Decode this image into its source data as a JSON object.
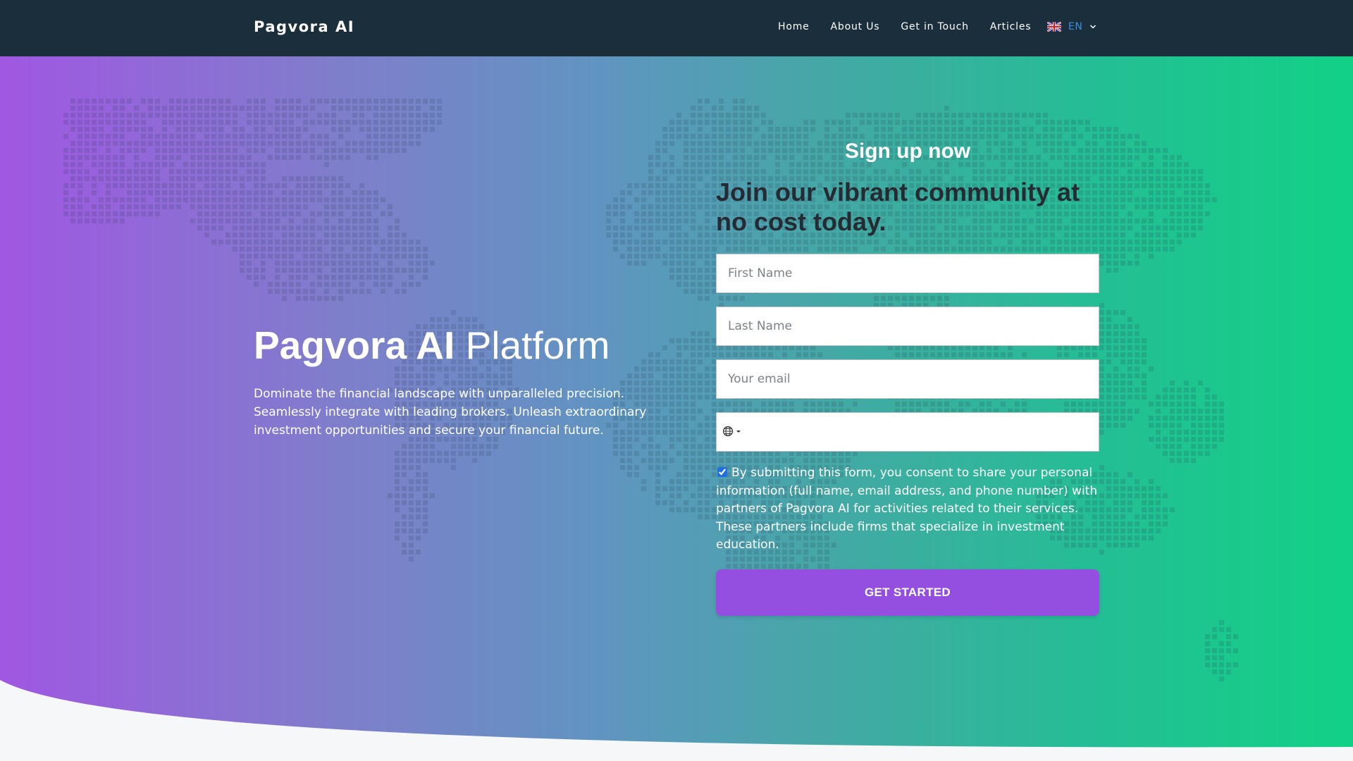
{
  "header": {
    "brand": "Pagvora AI",
    "nav": [
      {
        "label": "Home"
      },
      {
        "label": "About Us"
      },
      {
        "label": "Get in Touch"
      },
      {
        "label": "Articles"
      }
    ],
    "language": {
      "code": "EN",
      "flag_icon": "uk-flag-icon"
    }
  },
  "hero": {
    "title_bold": "Pagvora AI",
    "title_light": "Platform",
    "description": "Dominate the financial landscape with unparalleled precision. Seamlessly integrate with leading brokers. Unleash extraordinary investment opportunities and secure your financial future."
  },
  "form": {
    "heading": "Sign up now",
    "subheading": "Join our vibrant community at no cost today.",
    "first_name": {
      "placeholder": "First Name",
      "value": ""
    },
    "last_name": {
      "placeholder": "Last Name",
      "value": ""
    },
    "email": {
      "placeholder": "Your email",
      "value": ""
    },
    "phone": {
      "value": "",
      "country_icon": "globe-icon"
    },
    "consent": {
      "checked": true,
      "text": "By submitting this form, you consent to share your personal information (full name, email address, and phone number) with partners of Pagvora AI for activities related to their services. These partners include firms that specialize in investment education."
    },
    "submit_label": "GET STARTED"
  },
  "colors": {
    "header_bg": "#1a2e3b",
    "gradient_start": "#a057e2",
    "gradient_end": "#12d186",
    "cta_bg": "#944fe0",
    "lang_accent": "#3b8fe0"
  }
}
